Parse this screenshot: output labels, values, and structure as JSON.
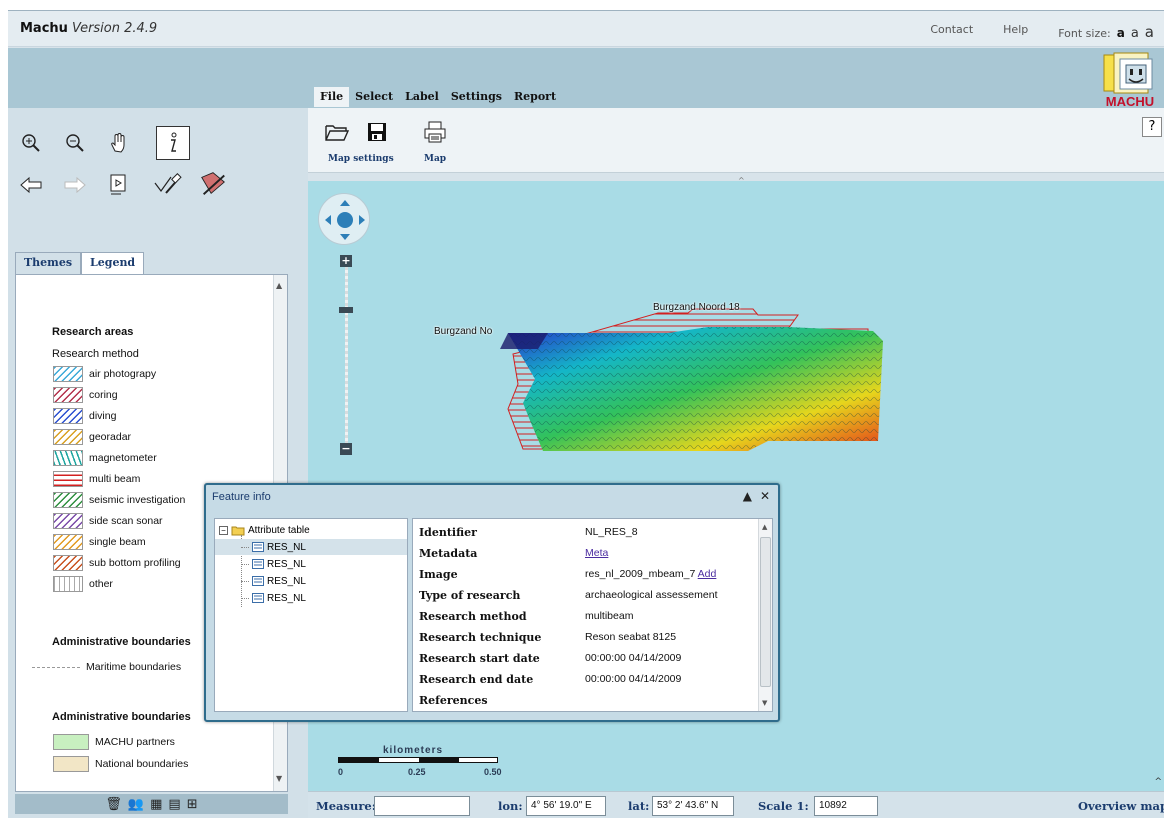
{
  "app": {
    "name": "Machu",
    "version": "Version 2.4.9",
    "logo_text": "MACHU"
  },
  "top_links": {
    "contact": "Contact",
    "help": "Help",
    "font_size_label": "Font size:",
    "font_a1": "a",
    "font_a2": "a",
    "font_a3": "a"
  },
  "menu": {
    "items": [
      "File",
      "Select",
      "Label",
      "Settings",
      "Report"
    ],
    "active": "File"
  },
  "toolbar": {
    "map_settings_label": "Map settings",
    "map_label": "Map",
    "help_label": "?"
  },
  "left_tabs": {
    "themes": "Themes",
    "legend": "Legend",
    "active": "Legend"
  },
  "legend": {
    "research_areas_title": "Research areas",
    "research_method_sub": "Research method",
    "methods": [
      {
        "label": "air photograpy",
        "color": "#3aa9d8"
      },
      {
        "label": "coring",
        "color": "#b3304b"
      },
      {
        "label": "diving",
        "color": "#2a4fd0"
      },
      {
        "label": "georadar",
        "color": "#d9a020"
      },
      {
        "label": "magnetometer",
        "color": "#1fa6a0"
      },
      {
        "label": "multi beam",
        "color": "#d32020"
      },
      {
        "label": "seismic investigation",
        "color": "#2e8f3e"
      },
      {
        "label": "side scan sonar",
        "color": "#7a4aa8"
      },
      {
        "label": "single beam",
        "color": "#e29a20"
      },
      {
        "label": "sub bottom profiling",
        "color": "#c8501e"
      },
      {
        "label": "other",
        "color": "#aaaaaa"
      }
    ],
    "admin1_title": "Administrative boundaries",
    "maritime": "Maritime boundaries",
    "admin2_title": "Administrative boundaries",
    "machu_partners": "MACHU partners",
    "machu_partners_color": "#c8f0c0",
    "national_boundaries": "National boundaries",
    "national_boundaries_color": "#f2e6c6"
  },
  "map": {
    "label_noord": "Burgzand Noord 18",
    "label_no": "Burgzand No",
    "scale_unit": "kilometers",
    "scale_ticks": [
      "0",
      "0.25",
      "0.50"
    ]
  },
  "feature_info": {
    "title": "Feature info",
    "tree_root": "Attribute table",
    "tree_items": [
      "RES_NL",
      "RES_NL",
      "RES_NL",
      "RES_NL"
    ],
    "selected_index": 0,
    "rows": [
      {
        "key": "Identifier",
        "value": "NL_RES_8"
      },
      {
        "key": "Metadata",
        "value": "Meta",
        "link": true
      },
      {
        "key": "Image",
        "value": "res_nl_2009_mbeam_7",
        "extra_link": "Add"
      },
      {
        "key": "Type of research",
        "value": "archaeological assessement"
      },
      {
        "key": "Research method",
        "value": "multibeam"
      },
      {
        "key": "Research technique",
        "value": "Reson seabat 8125"
      },
      {
        "key": "Research start date",
        "value": "00:00:00 04/14/2009"
      },
      {
        "key": "Research end date",
        "value": "00:00:00 04/14/2009"
      },
      {
        "key": "References",
        "value": ""
      }
    ]
  },
  "status": {
    "measure_label": "Measure:",
    "measure_value": "",
    "lon_label": "lon:",
    "lon_value": "4° 56' 19.0\" E",
    "lat_label": "lat:",
    "lat_value": "53° 2' 43.6\" N",
    "scale_label": "Scale 1:",
    "scale_value": "10892",
    "overview": "Overview map"
  }
}
